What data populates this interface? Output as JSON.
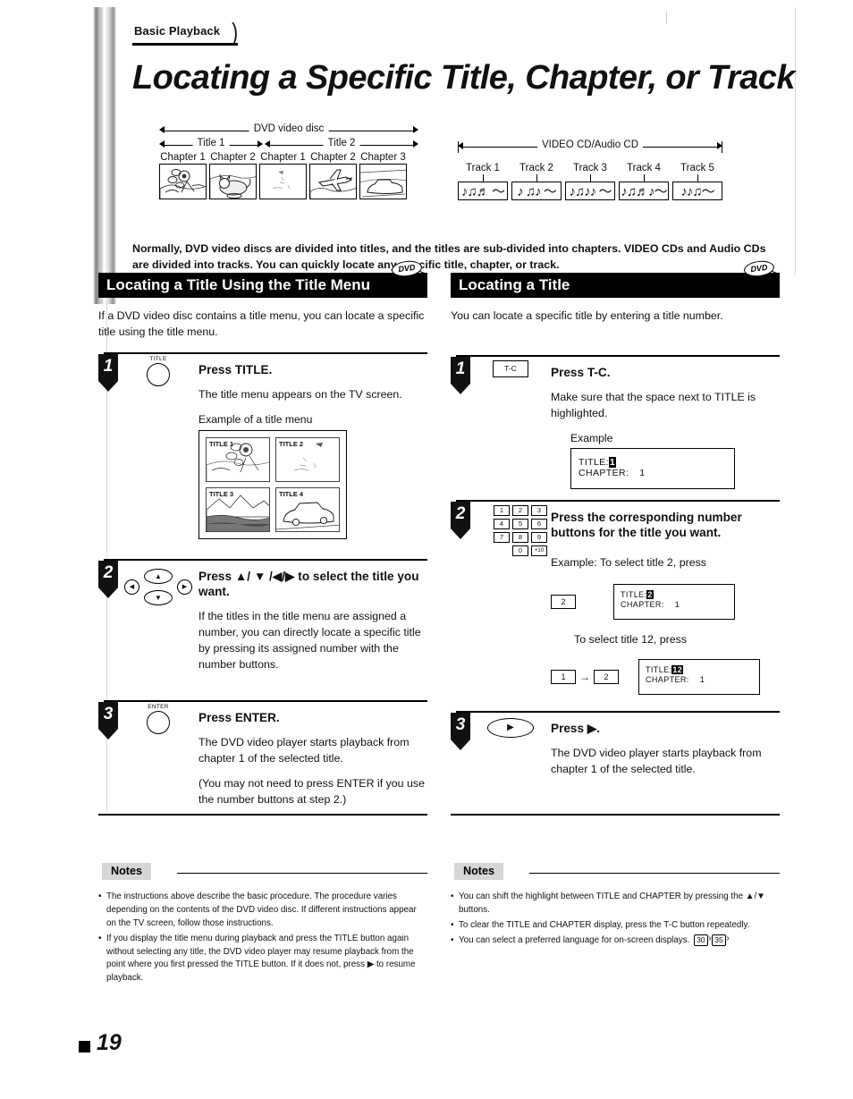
{
  "header": {
    "kicker": "Basic Playback",
    "title": "Locating a Specific Title, Chapter, or Track"
  },
  "diagrams": {
    "dvd": {
      "span_label": "DVD video disc",
      "titles": [
        {
          "label": "Title 1",
          "chapters": [
            "Chapter 1",
            "Chapter 2"
          ]
        },
        {
          "label": "Title 2",
          "chapters": [
            "Chapter 1",
            "Chapter 2",
            "Chapter 3"
          ]
        }
      ]
    },
    "cd": {
      "span_label": "VIDEO CD/Audio CD",
      "tracks": [
        "Track 1",
        "Track 2",
        "Track 3",
        "Track 4",
        "Track 5"
      ],
      "note_glyphs": [
        "♪♫♬ 〜",
        "♪ ♫♪ 〜",
        "♪♫♪♪ 〜",
        "♪♫♬♪〜",
        "♪♪♫〜"
      ]
    }
  },
  "intro": "Normally, DVD video discs are divided into titles, and the titles are sub-divided into chapters. VIDEO CDs and Audio CDs are divided into tracks. You can quickly locate any specific title, chapter, or track.",
  "left_column": {
    "section_title": "Locating a Title Using the Title Menu",
    "badge": "DVD",
    "lead": "If a DVD video disc contains a title menu, you can locate a specific title using the title menu.",
    "steps": [
      {
        "num": "1",
        "icon_label": "TITLE",
        "heading": "Press TITLE.",
        "body": "The title menu appears on the TV screen.",
        "example_caption": "Example of a title menu",
        "menu_titles": [
          "TITLE 1",
          "TITLE 2",
          "TITLE 3",
          "TITLE 4"
        ]
      },
      {
        "num": "2",
        "heading": "Press ▲/ ▼ /◀/▶  to select the title you want.",
        "body": "If the titles in the title menu are assigned a number, you can directly locate a specific title by pressing its assigned number with the number buttons.",
        "dpad": {
          "up": "▲",
          "down": "▼",
          "left": "◀",
          "right": "▶"
        }
      },
      {
        "num": "3",
        "icon_label": "ENTER",
        "heading": "Press ENTER.",
        "body": "The DVD video player starts playback from chapter 1 of the selected title.",
        "body2": "(You may not need to press ENTER if you use the number buttons at step 2.)"
      }
    ],
    "notes_title": "Notes",
    "notes": [
      "The instructions above describe the basic procedure. The procedure varies depending on the contents of the DVD video disc. If different instructions appear on the TV screen, follow those instructions.",
      "If you display the title menu during playback and press the TITLE button again without selecting any title, the DVD video player may resume playback from the point where you first pressed the TITLE button. If it does not, press ▶ to resume playback."
    ]
  },
  "right_column": {
    "section_title": "Locating a Title",
    "badge": "DVD",
    "lead": "You can locate a specific title by entering a title number.",
    "steps": [
      {
        "num": "1",
        "icon_label": "T-C",
        "heading": "Press T-C.",
        "body": "Make sure that the space next to TITLE is highlighted.",
        "example_caption": "Example",
        "osd": {
          "title_label": "TITLE:",
          "title_value": "1",
          "chapter_label": "CHAPTER:",
          "chapter_value": "1"
        }
      },
      {
        "num": "2",
        "heading": "Press the corresponding number buttons for the title you want.",
        "keypad": [
          "1",
          "2",
          "3",
          "4",
          "5",
          "6",
          "7",
          "8",
          "9",
          "0",
          "+10"
        ],
        "example1_caption": "Example: To select title 2, press",
        "example1_key": "2",
        "example1_osd": {
          "title_label": "TITLE:",
          "title_value": "2",
          "chapter_label": "CHAPTER:",
          "chapter_value": "1"
        },
        "example2_caption": "To select title 12, press",
        "example2_key1": "1",
        "example2_arrow": "→",
        "example2_key2": "2",
        "example2_osd": {
          "title_label": "TITLE:",
          "title_value": "12",
          "chapter_label": "CHAPTER:",
          "chapter_value": "1"
        }
      },
      {
        "num": "3",
        "icon_label": "▶",
        "heading": "Press ▶.",
        "body": "The DVD video player starts playback from chapter 1 of the selected title."
      }
    ],
    "notes_title": "Notes",
    "notes": [
      "You can shift the highlight between TITLE and CHAPTER by pressing the ▲/▼ buttons.",
      "To clear the TITLE and CHAPTER display, press the T-C button repeatedly.",
      "You can select a preferred language for on-screen displays."
    ],
    "note_refs": [
      "30",
      "35"
    ]
  },
  "footer": {
    "page_number": "19"
  }
}
